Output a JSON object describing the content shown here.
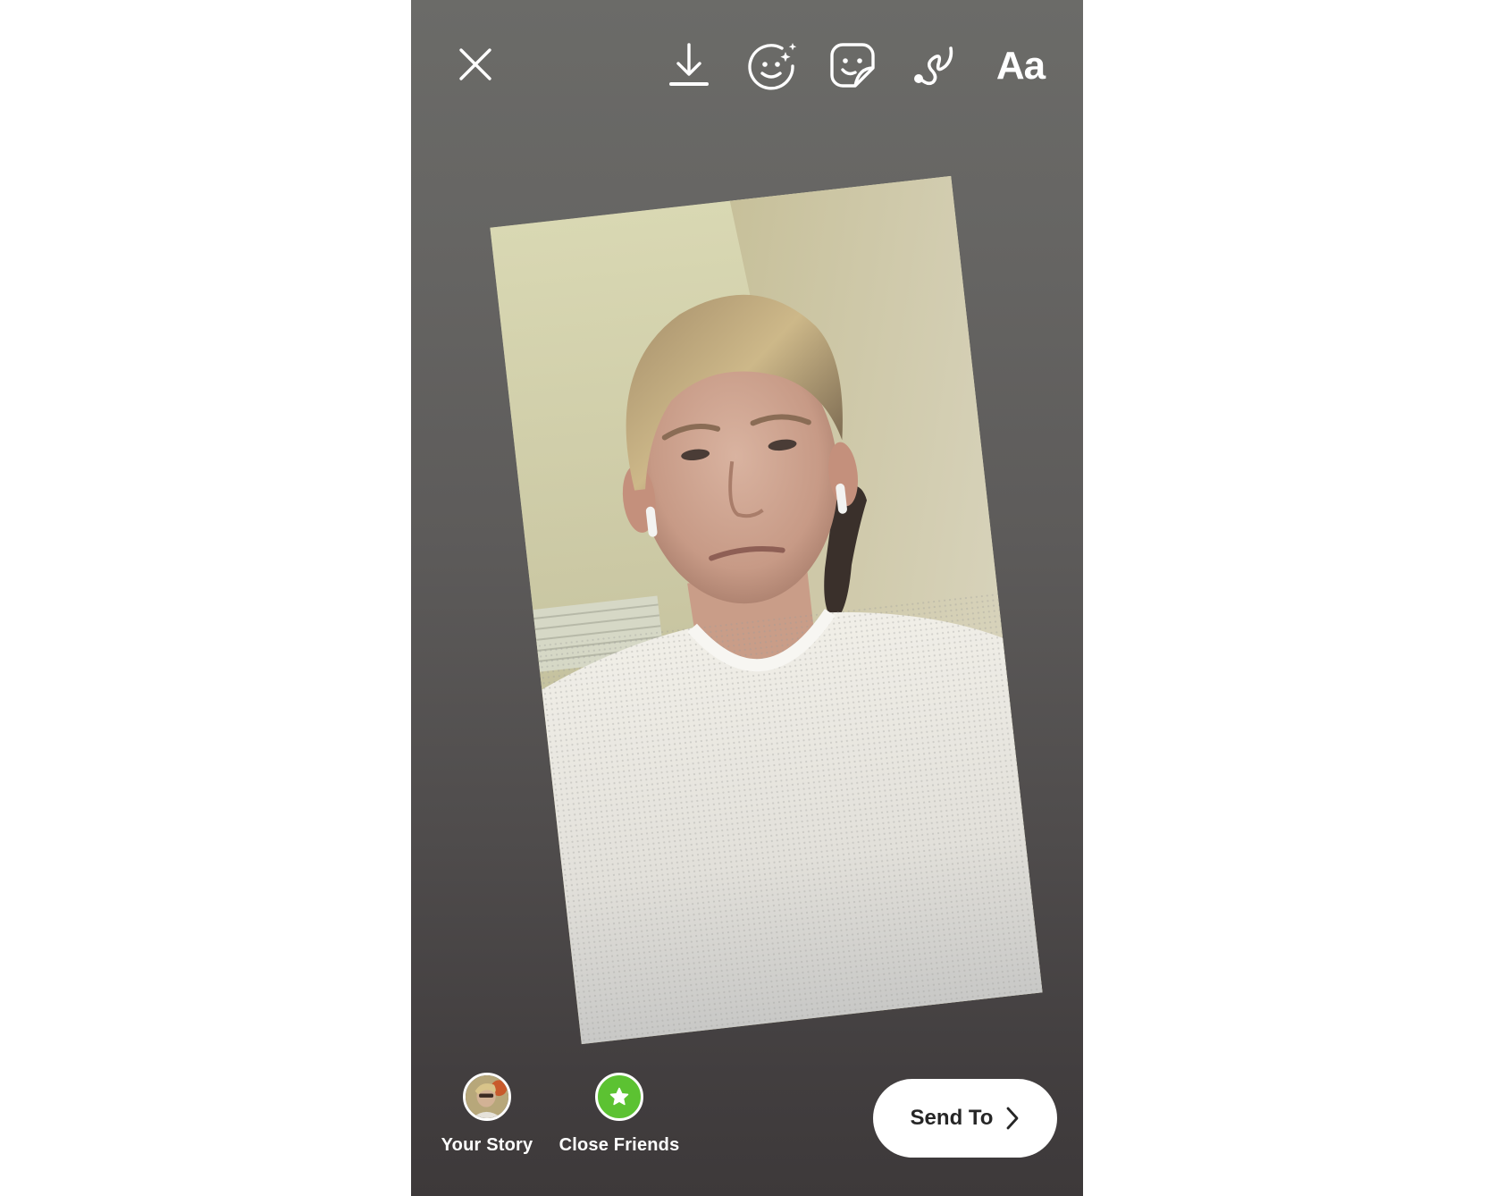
{
  "screen": "instagram-story-editor",
  "colors": {
    "background_top": "#6b6b68",
    "background_bottom": "#3d393a",
    "icon": "#ffffff",
    "close_friends_green": "#5cc232",
    "send_button_bg": "#ffffff",
    "send_button_text": "#262626"
  },
  "toolbar": {
    "close_icon": "close-icon",
    "download_icon": "download-icon",
    "effects_icon": "face-effects-icon",
    "sticker_icon": "sticker-icon",
    "draw_icon": "draw-icon",
    "text_label": "Aa"
  },
  "photo": {
    "description": "Selfie of a young man with blond hair wearing a white waffle-knit shirt and white earbuds, indoors",
    "rotation_deg": -6.4
  },
  "destinations": [
    {
      "label": "Your Story",
      "icon": "profile-avatar"
    },
    {
      "label": "Close Friends",
      "icon": "star-icon"
    }
  ],
  "send_button": {
    "label": "Send To",
    "icon": "chevron-right-icon"
  }
}
